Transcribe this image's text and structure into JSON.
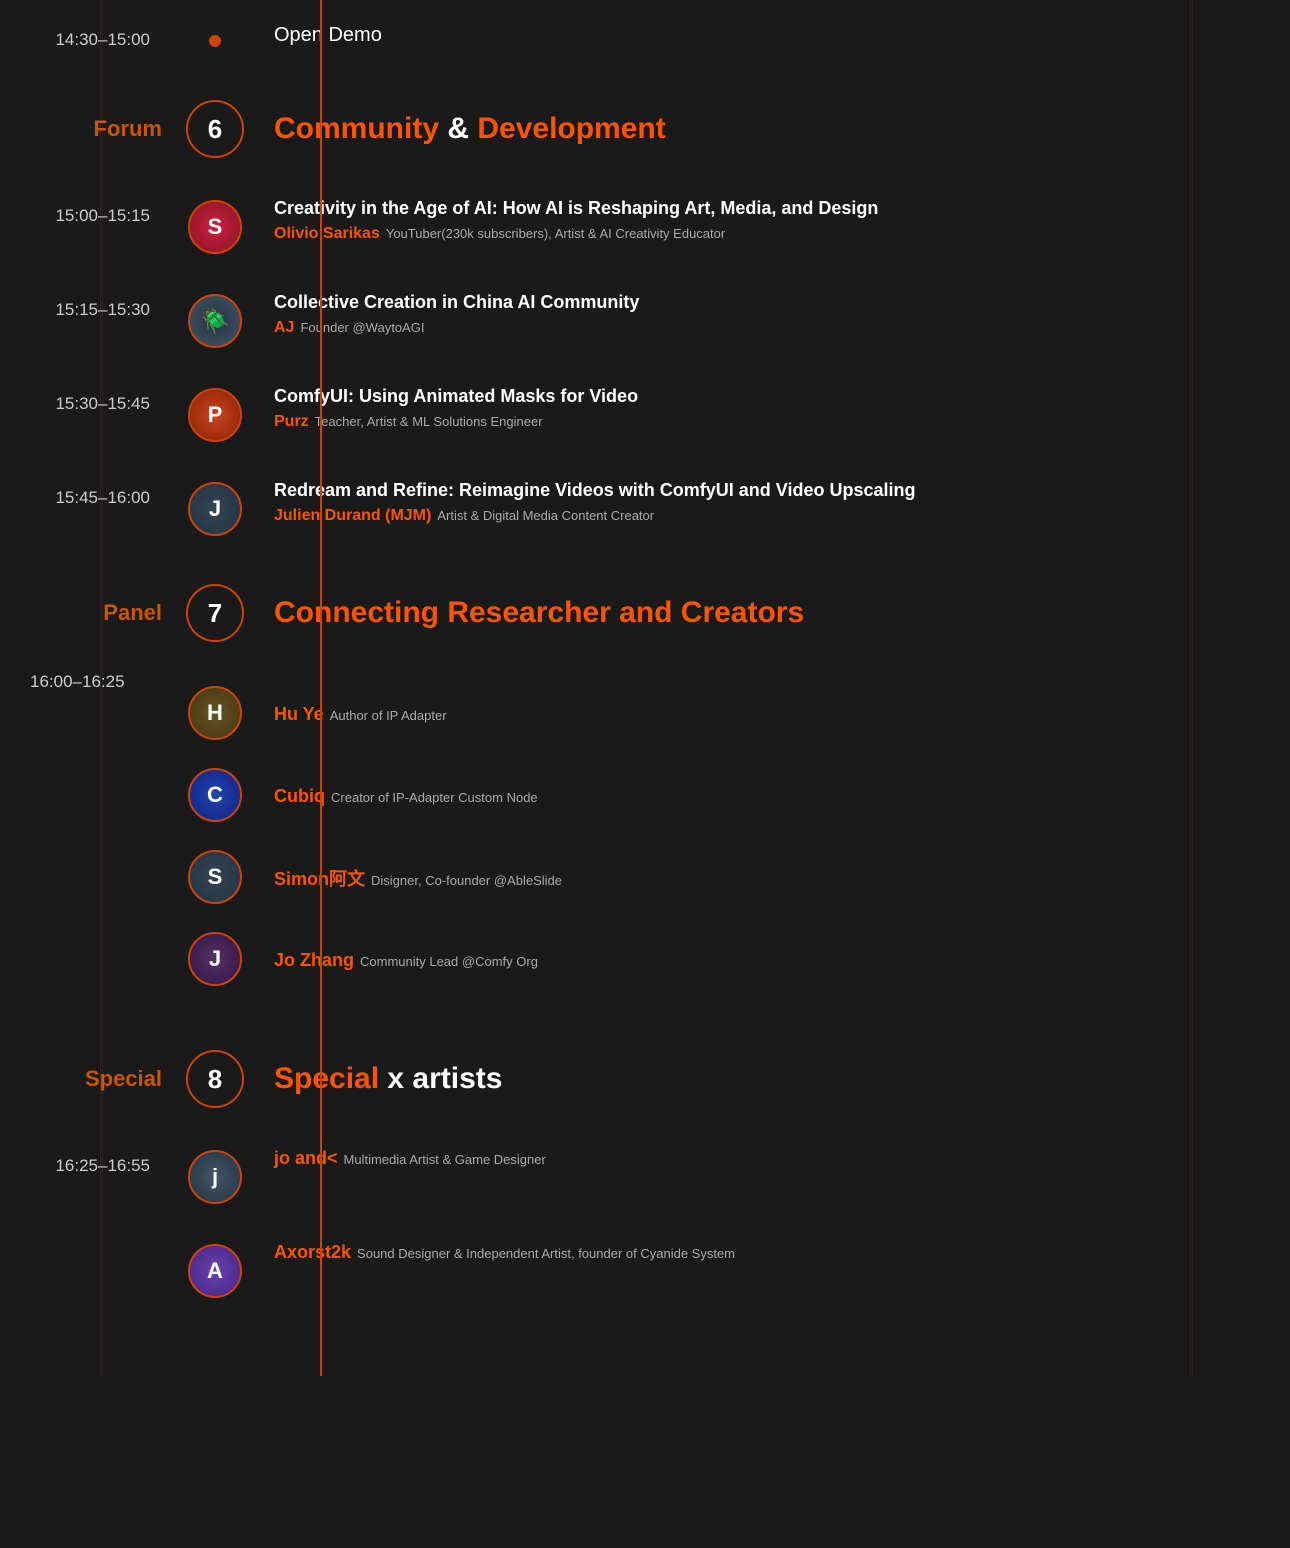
{
  "colors": {
    "orange": "#ff5500",
    "dark_orange": "#cc4400",
    "bg": "#1a1a1a",
    "text": "#ffffff",
    "muted": "#aaaaaa",
    "time": "#cccccc"
  },
  "open_demo": {
    "time": "14:30–15:00",
    "title": "Open Demo"
  },
  "forum": {
    "label": "Forum",
    "number": "6",
    "title_part1": "Community",
    "title_connector": " & ",
    "title_part2": "Development",
    "talks": [
      {
        "time": "15:00–15:15",
        "title": "Creativity in the Age of AI: How AI is Reshaping Art, Media, and Design",
        "speaker": "Olivio Sarikas",
        "role": "YouTuber(230k subscribers), Artist & AI Creativity Educator",
        "avatar_class": "av-s",
        "avatar_letter": "S"
      },
      {
        "time": "15:15–15:30",
        "title": "Collective Creation in China AI Community",
        "speaker": "AJ",
        "role": "Founder @WaytoAGI",
        "avatar_class": "av-beetle",
        "avatar_letter": "🪲"
      },
      {
        "time": "15:30–15:45",
        "title": "ComfyUI: Using Animated Masks for Video",
        "speaker": "Purz",
        "role": "Teacher, Artist & ML Solutions Engineer",
        "avatar_class": "av-purz",
        "avatar_letter": "P"
      },
      {
        "time": "15:45–16:00",
        "title": "Redream and Refine: Reimagine Videos with ComfyUI and Video Upscaling",
        "speaker": "Julien Durand (MJM)",
        "role": "Artist & Digital Media Content Creator",
        "avatar_class": "av-julien",
        "avatar_letter": "J"
      }
    ]
  },
  "panel": {
    "label": "Panel",
    "number": "7",
    "title": "Connecting Researcher and Creators",
    "time": "16:00–16:25",
    "participants": [
      {
        "name": "Hu Ye",
        "role": "Author of IP Adapter",
        "avatar_class": "av-huye",
        "avatar_letter": "H"
      },
      {
        "name": "Cubiq",
        "role": "Creator of IP-Adapter Custom Node",
        "avatar_class": "av-cubiq",
        "avatar_letter": "C"
      },
      {
        "name": "Simon阿文",
        "role": "Disigner, Co-founder @AbleSlide",
        "avatar_class": "av-simon",
        "avatar_letter": "S"
      },
      {
        "name": "Jo Zhang",
        "role": "Community Lead @Comfy Org",
        "avatar_class": "av-jo",
        "avatar_letter": "J"
      }
    ]
  },
  "special": {
    "label": "Special",
    "number": "8",
    "title_part1": "Special",
    "title_connector": " x ",
    "title_part2": "artists",
    "time": "16:25–16:55",
    "artists": [
      {
        "name": "jo and<",
        "role": "Multimedia Artist & Game Designer",
        "avatar_class": "av-joane",
        "avatar_letter": "j"
      },
      {
        "name": "Axorst2k",
        "role": "Sound Designer & Independent Artist, founder of Cyanide System",
        "avatar_class": "av-axorst",
        "avatar_letter": "A"
      }
    ]
  }
}
